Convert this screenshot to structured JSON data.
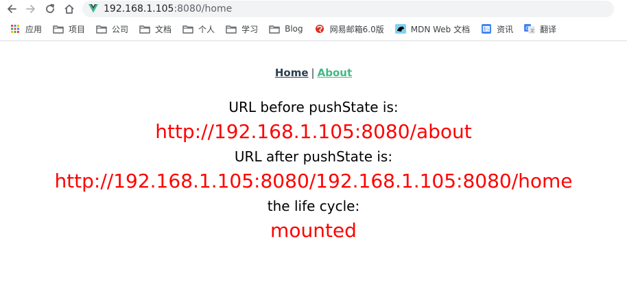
{
  "browser": {
    "address_bar": {
      "host": "192.168.1.105",
      "path": ":8080/home"
    },
    "bookmarks": [
      {
        "label": "应用",
        "icon": "apps-grid-icon"
      },
      {
        "label": "项目",
        "icon": "folder-icon"
      },
      {
        "label": "公司",
        "icon": "folder-icon"
      },
      {
        "label": "文档",
        "icon": "folder-icon"
      },
      {
        "label": "个人",
        "icon": "folder-icon"
      },
      {
        "label": "学习",
        "icon": "folder-icon"
      },
      {
        "label": "Blog",
        "icon": "folder-icon"
      },
      {
        "label": "网易邮箱6.0版",
        "icon": "netease-mail-icon"
      },
      {
        "label": "MDN Web 文档",
        "icon": "mdn-icon"
      },
      {
        "label": "资讯",
        "icon": "google-news-icon"
      },
      {
        "label": "翻译",
        "icon": "google-translate-icon"
      }
    ]
  },
  "page": {
    "nav": {
      "home": "Home",
      "separator": "|",
      "about": "About"
    },
    "before_label": "URL before pushState is:",
    "before_value": "http://192.168.1.105:8080/about",
    "after_label": "URL after pushState is:",
    "after_value": "http://192.168.1.105:8080/192.168.1.105:8080/home",
    "lifecycle_label": "the life cycle:",
    "lifecycle_value": "mounted"
  },
  "colors": {
    "vue_green": "#42b983",
    "vue_dark": "#2c3e50",
    "value_red": "#ff0000"
  }
}
